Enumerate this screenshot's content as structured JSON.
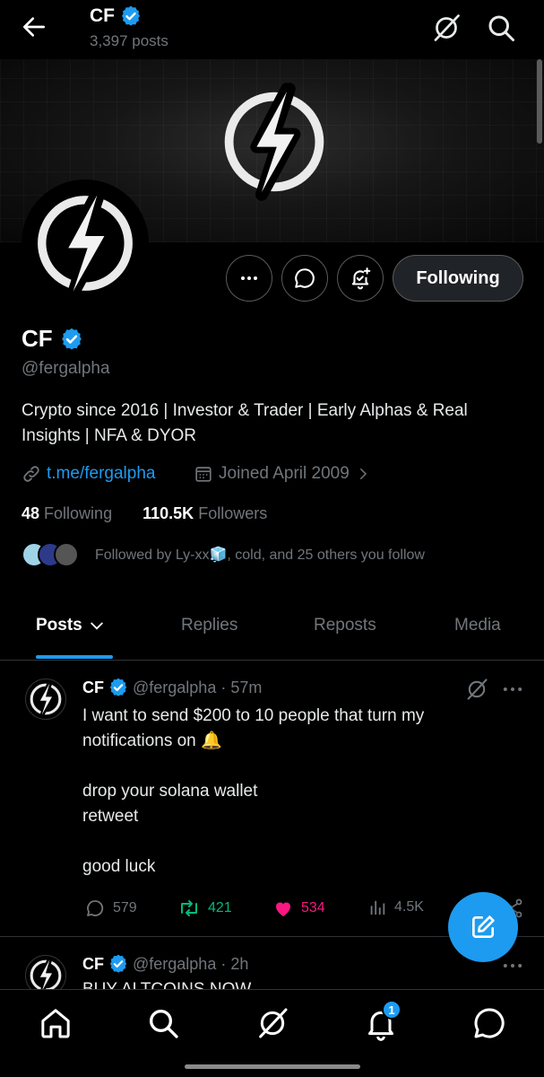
{
  "header": {
    "name": "CF",
    "posts_count": "3,397 posts"
  },
  "profile": {
    "name": "CF",
    "handle": "@fergalpha",
    "bio": "Crypto since 2016 | Investor & Trader | Early Alphas & Real Insights | NFA & DYOR",
    "link": "t.me/fergalpha",
    "joined": "Joined April 2009",
    "following_count": "48",
    "following_label": "Following",
    "followers_count": "110.5K",
    "followers_label": "Followers",
    "followed_by": "Followed by Ly-xx🧊, cold, and 25 others you follow"
  },
  "buttons": {
    "following": "Following"
  },
  "tabs": [
    {
      "label": "Posts"
    },
    {
      "label": "Replies"
    },
    {
      "label": "Reposts"
    },
    {
      "label": "Media"
    }
  ],
  "tweets": [
    {
      "name": "CF",
      "handle": "@fergalpha",
      "time": "· 57m",
      "text": "I want to send $200 to 10 people that turn my notifications on 🔔\n\ndrop your solana wallet\nretweet\n\ngood luck",
      "replies": "579",
      "reposts": "421",
      "likes": "534",
      "views": "4.5K"
    },
    {
      "name": "CF",
      "handle": "@fergalpha",
      "time": "· 2h",
      "text": "BUY ALTCOINS NOW"
    }
  ],
  "notifications_badge": "1",
  "colors": {
    "accent": "#1d9bf0",
    "repost": "#00ba7c",
    "like": "#f91880",
    "muted": "#71767b"
  },
  "icons": [
    "back-arrow-icon",
    "grok-icon",
    "search-icon",
    "more-icon",
    "message-icon",
    "notification-bell-icon",
    "verified-badge-icon",
    "link-icon",
    "calendar-icon",
    "reply-icon",
    "repost-icon",
    "like-icon",
    "views-icon",
    "compose-icon",
    "home-icon",
    "chat-icon"
  ]
}
